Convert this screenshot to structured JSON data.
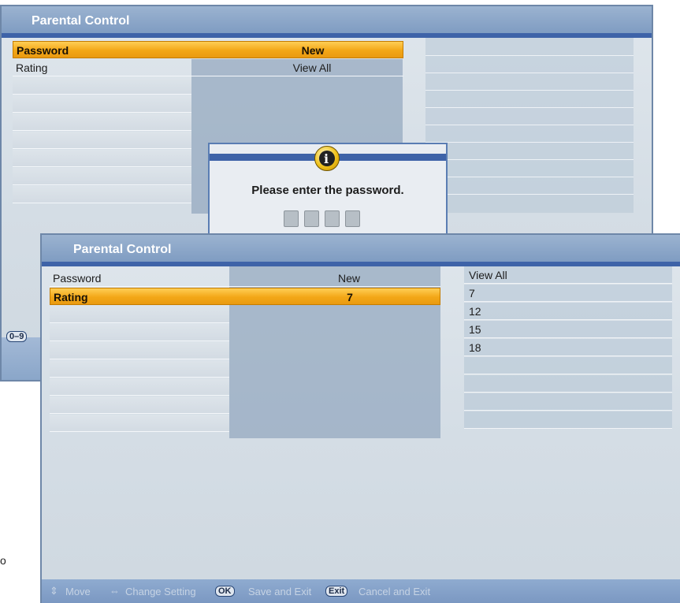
{
  "back": {
    "title": "Parental Control",
    "rows": [
      {
        "label": "Password",
        "value": "New"
      },
      {
        "label": "Rating",
        "value": "View All"
      }
    ],
    "key_hint": "0–9",
    "dialog": {
      "icon": "info-icon",
      "icon_glyph": "i",
      "message": "Please enter the password.",
      "pin_boxes": 4
    }
  },
  "front": {
    "title": "Parental Control",
    "rows": [
      {
        "label": "Password",
        "value": "New"
      },
      {
        "label": "Rating",
        "value": "7"
      }
    ],
    "options": [
      "View All",
      "7",
      "12",
      "15",
      "18"
    ],
    "help": {
      "move": "Move",
      "change": "Change Setting",
      "ok_key": "OK",
      "ok": "Save and Exit",
      "exit_key": "Exit",
      "exit": "Cancel and Exit"
    }
  },
  "stray_text": "o",
  "colors": {
    "highlight": "#f3a717",
    "accent": "#3e63a8",
    "titlebar": "#8aa6c9"
  }
}
